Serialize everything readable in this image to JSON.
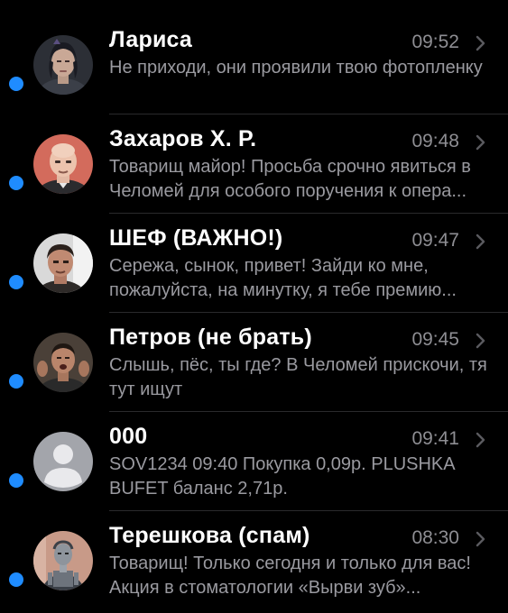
{
  "accent_color": "#1f8cff",
  "conversations": [
    {
      "name": "Лариса",
      "time": "09:52",
      "preview": "Не приходи, они проявили твою фотопленку",
      "unread": true,
      "avatar": "woman-portrait"
    },
    {
      "name": "Захаров Х. Р.",
      "time": "09:48",
      "preview": "Товарищ майор! Просьба срочно явиться в Челомей для особого поручения к опера...",
      "unread": true,
      "avatar": "bald-man-portrait"
    },
    {
      "name": "ШЕФ (ВАЖНО!)",
      "time": "09:47",
      "preview": "Сережа, сынок, привет! Зайди ко мне, пожалуйста, на минутку, я тебе премию...",
      "unread": true,
      "avatar": "man-portrait"
    },
    {
      "name": "Петров (не брать)",
      "time": "09:45",
      "preview": "Слышь, пёс, ты где? В Челомей прискочи, тя тут ищут",
      "unread": true,
      "avatar": "shouting-man-portrait"
    },
    {
      "name": "000",
      "time": "09:41",
      "preview": "SOV1234 09:40 Покупка 0,09р. PLUSHKA BUFET баланс 2,71р.",
      "unread": true,
      "avatar": "default-person-icon"
    },
    {
      "name": "Терешкова (спам)",
      "time": "08:30",
      "preview": "Товарищ! Только сегодня и только для вас! Акция в стоматологии «Вырви зуб»...",
      "unread": true,
      "avatar": "robot-woman-portrait"
    }
  ]
}
